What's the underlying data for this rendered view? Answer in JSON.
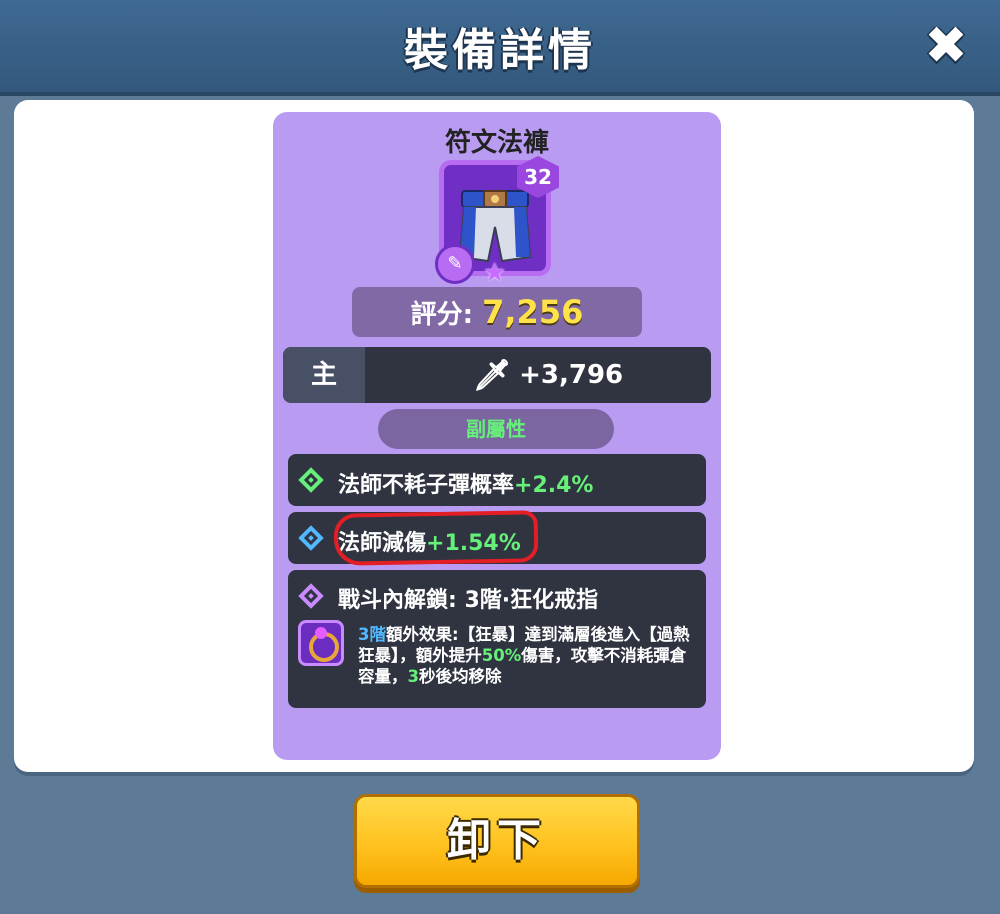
{
  "header": {
    "title": "裝備詳情",
    "close_icon": "close-icon"
  },
  "item": {
    "name": "符文法褲",
    "level": "32",
    "score_label": "評分:",
    "score_value": "7,256",
    "main_label": "主",
    "main_stat_icon": "sword-icon",
    "main_value": "+3,796"
  },
  "sub_attributes": {
    "header": "副屬性",
    "items": [
      {
        "label": "法師不耗子彈概率",
        "value": "+2.4%",
        "icon": "diamond-green-icon"
      },
      {
        "label": "法師減傷",
        "value": "+1.54%",
        "icon": "diamond-blue-icon"
      }
    ]
  },
  "unlock": {
    "label": "戰斗內解鎖: 3階·狂化戒指",
    "effect_tier": "3階",
    "effect_part1": "額外效果:【狂暴】達到滿層後進入【過熱狂暴】，額外提升",
    "effect_pct": "50%",
    "effect_part2": "傷害，攻擊不消耗彈倉容量，",
    "effect_secs": "3",
    "effect_part3": "秒後均移除"
  },
  "actions": {
    "unequip_label": "卸下"
  },
  "colors": {
    "accent_green": "#66f07a",
    "accent_blue": "#52b8ff",
    "card_bg": "#b99bf2",
    "button_yellow": "#ffc21f",
    "highlight_red": "#e31e24"
  }
}
